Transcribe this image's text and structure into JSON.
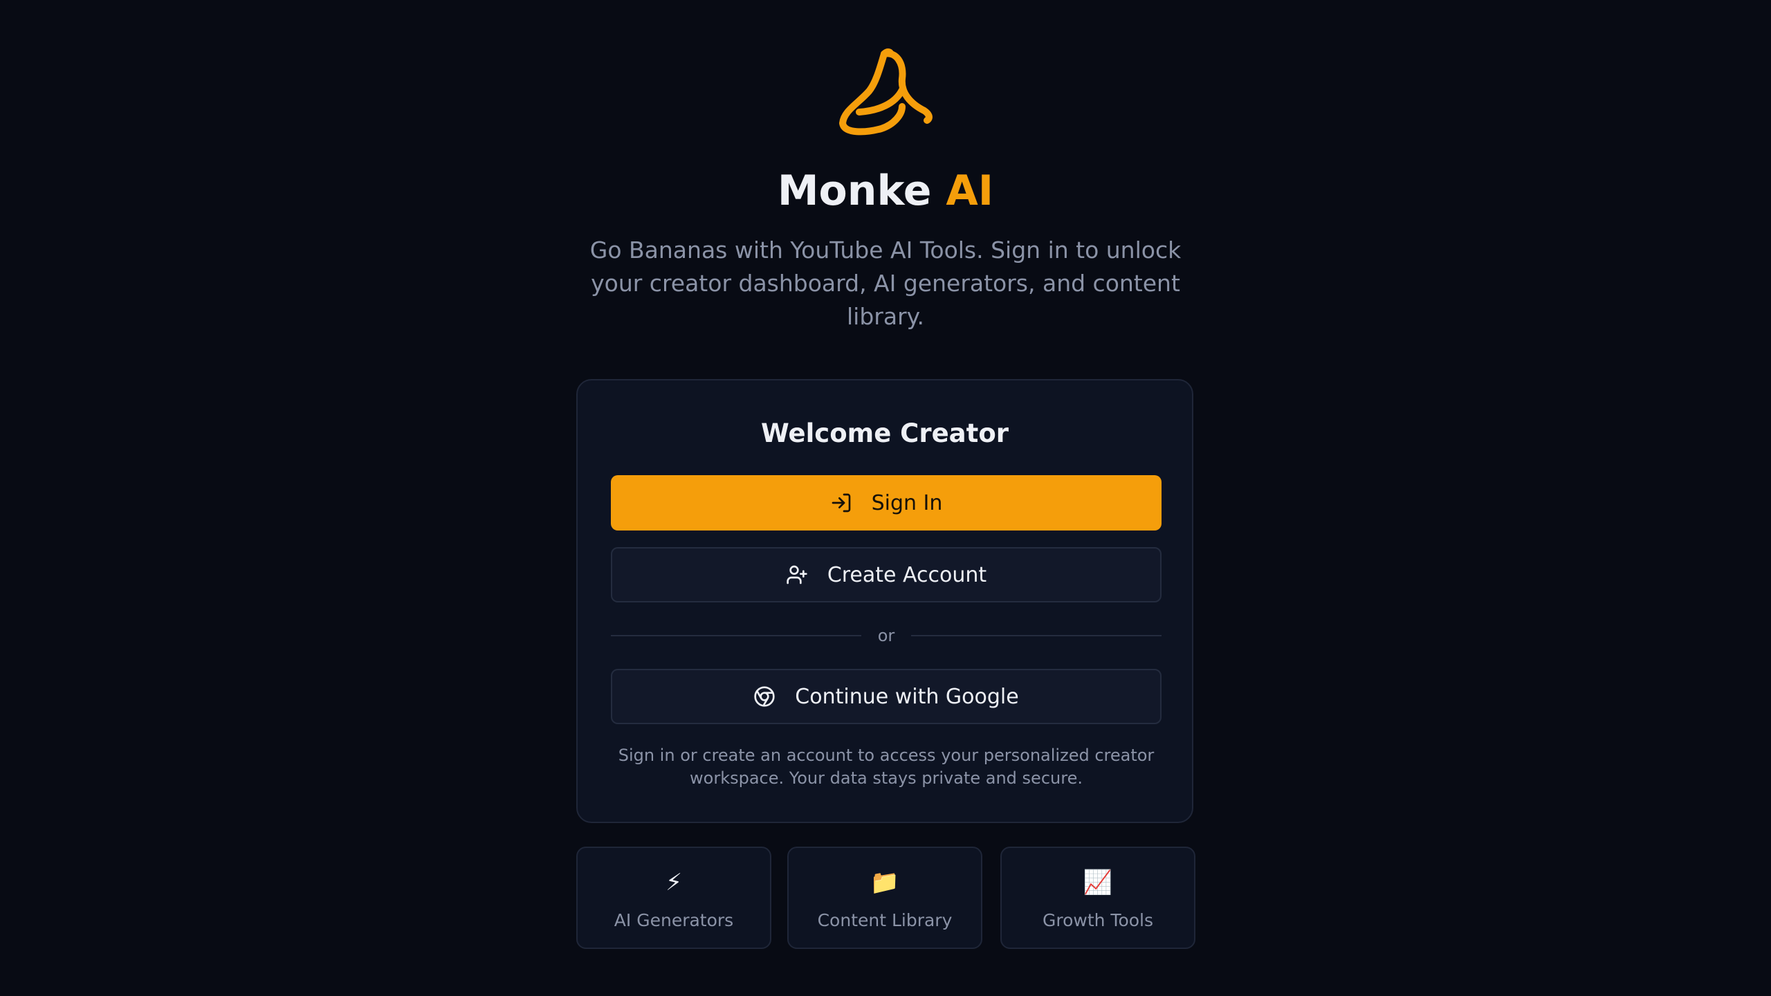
{
  "brand": {
    "name": "Monke",
    "accent": "AI",
    "logo_icon": "banana-icon",
    "accent_color": "#f59e0b"
  },
  "hero": {
    "subtitle": "Go Bananas with YouTube AI Tools. Sign in to unlock your creator dashboard, AI generators, and content library."
  },
  "auth_card": {
    "title": "Welcome Creator",
    "sign_in": {
      "label": "Sign In",
      "icon": "sign-in-icon"
    },
    "create_account": {
      "label": "Create Account",
      "icon": "user-plus-icon"
    },
    "divider": "or",
    "google": {
      "label": "Continue with Google",
      "icon": "chrome-icon"
    },
    "note": "Sign in or create an account to access your personalized creator workspace. Your data stays private and secure."
  },
  "features": [
    {
      "icon": "⚡",
      "icon_name": "lightning-icon",
      "label": "AI Generators"
    },
    {
      "icon": "📁",
      "icon_name": "folder-icon",
      "label": "Content Library"
    },
    {
      "icon": "📈",
      "icon_name": "chart-up-icon",
      "label": "Growth Tools"
    }
  ]
}
